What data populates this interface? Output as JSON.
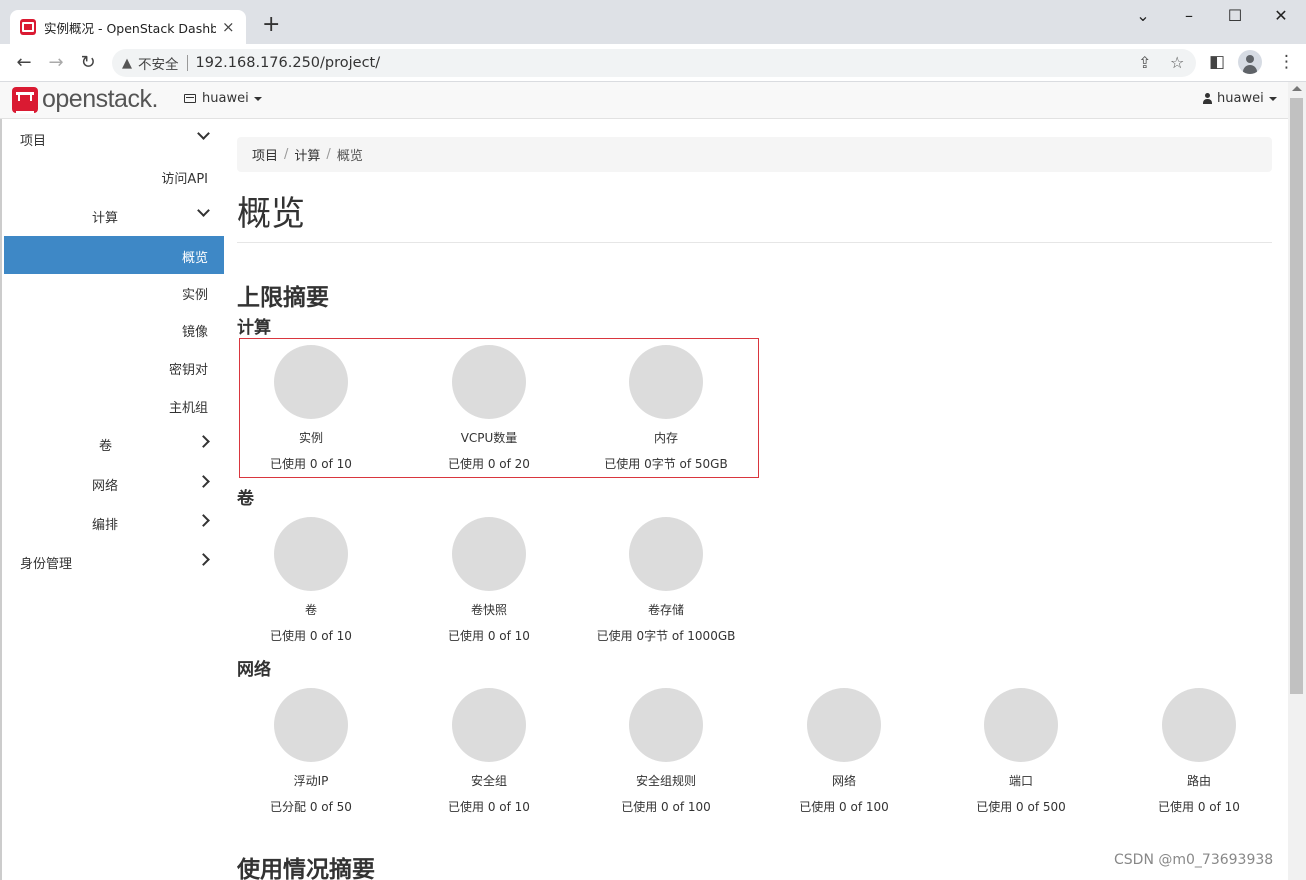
{
  "browser": {
    "tab_title": "实例概况 - OpenStack Dashboard",
    "tab_close": "×",
    "new_tab": "+",
    "insecure_label": "不安全",
    "url": "192.168.176.250/project/"
  },
  "header": {
    "logo_text": "openstack.",
    "project": "huawei",
    "user": "huawei"
  },
  "sidebar": {
    "project": "项目",
    "api_access": "访问API",
    "compute": "计算",
    "overview": "概览",
    "instances": "实例",
    "images": "镜像",
    "keypairs": "密钥对",
    "server_groups": "主机组",
    "volumes": "卷",
    "network": "网络",
    "orchestration": "编排",
    "identity": "身份管理"
  },
  "breadcrumb": {
    "item1": "项目",
    "item2": "计算",
    "item3": "概览",
    "sep": "/"
  },
  "main": {
    "page_title": "概览",
    "limit_summary": "上限摘要",
    "usage_summary": "使用情况摘要",
    "sections": {
      "compute": "计算",
      "volume": "卷",
      "network": "网络"
    },
    "compute_pies": [
      {
        "title": "实例",
        "usage": "已使用 0 of 10",
        "fraction": 0
      },
      {
        "title": "VCPU数量",
        "usage": "已使用 0 of 20",
        "fraction": 0
      },
      {
        "title": "内存",
        "usage": "已使用 0字节 of 50GB",
        "fraction": 0
      }
    ],
    "volume_pies": [
      {
        "title": "卷",
        "usage": "已使用 0 of 10",
        "fraction": 0
      },
      {
        "title": "卷快照",
        "usage": "已使用 0 of 10",
        "fraction": 0
      },
      {
        "title": "卷存储",
        "usage": "已使用 0字节 of 1000GB",
        "fraction": 0
      }
    ],
    "network_pies": [
      {
        "title": "浮动IP",
        "usage": "已分配 0 of 50",
        "fraction": 0
      },
      {
        "title": "安全组",
        "usage": "已使用 0 of 10",
        "fraction": 0
      },
      {
        "title": "安全组规则",
        "usage": "已使用 0 of 100",
        "fraction": 0
      },
      {
        "title": "网络",
        "usage": "已使用 0 of 100",
        "fraction": 0
      },
      {
        "title": "端口",
        "usage": "已使用 0 of 500",
        "fraction": 0
      },
      {
        "title": "路由",
        "usage": "已使用 0 of 10",
        "fraction": 0
      }
    ]
  },
  "watermark": "CSDN @m0_73693938",
  "colors": {
    "active_nav": "#3e88c6",
    "highlight_border": "#d9363e",
    "pie_empty": "#dcdcdc",
    "brand_red": "#da1a32"
  }
}
